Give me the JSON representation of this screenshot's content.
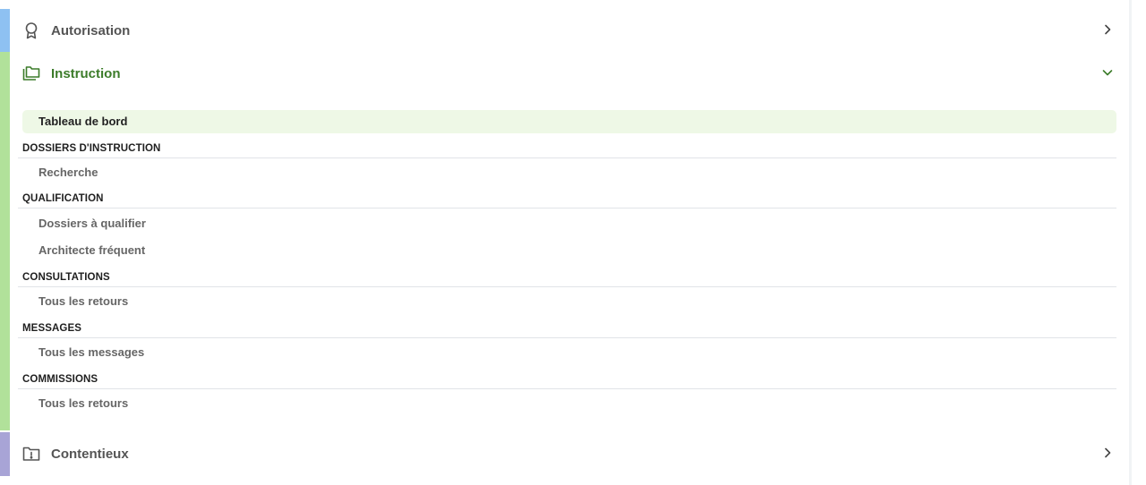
{
  "sections": {
    "autorisation": {
      "title": "Autorisation",
      "icon": "award-icon"
    },
    "instruction": {
      "title": "Instruction",
      "icon": "folders-icon",
      "dashboard": "Tableau de bord",
      "groups": [
        {
          "label": "DOSSIERS D'INSTRUCTION",
          "items": [
            "Recherche"
          ]
        },
        {
          "label": "QUALIFICATION",
          "items": [
            "Dossiers à qualifier",
            "Architecte fréquent"
          ]
        },
        {
          "label": "CONSULTATIONS",
          "items": [
            "Tous les retours"
          ]
        },
        {
          "label": "MESSAGES",
          "items": [
            "Tous les messages"
          ]
        },
        {
          "label": "COMMISSIONS",
          "items": [
            "Tous les retours"
          ]
        }
      ]
    },
    "contentieux": {
      "title": "Contentieux",
      "icon": "folder-alert-icon"
    }
  },
  "colors": {
    "autorisation_accent": "#8ec1f2",
    "instruction_accent": "#b1e19a",
    "contentieux_accent": "#a8a4d6",
    "instruction_title": "#3c7c2a",
    "active_item_bg": "#eef8e6"
  }
}
